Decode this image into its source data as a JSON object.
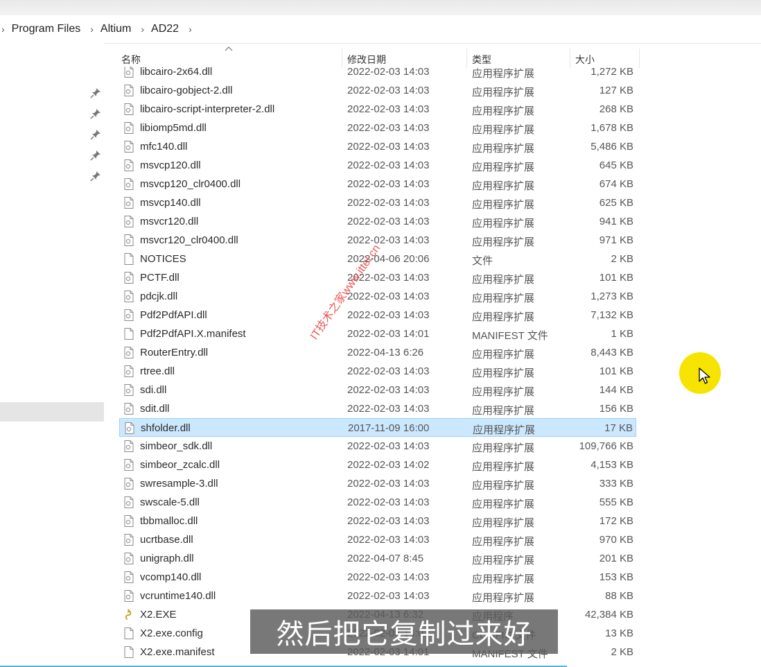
{
  "breadcrumb": [
    "Program Files",
    "Altium",
    "AD22"
  ],
  "columns": {
    "name": "名称",
    "date": "修改日期",
    "type": "类型",
    "size": "大小"
  },
  "files": [
    {
      "name": "libcairo-2x64.dll",
      "date": "2022-02-03 14:03",
      "type": "应用程序扩展",
      "size": "1,272 KB",
      "icon": "dll-file-icon"
    },
    {
      "name": "libcairo-gobject-2.dll",
      "date": "2022-02-03 14:03",
      "type": "应用程序扩展",
      "size": "127 KB",
      "icon": "dll-file-icon"
    },
    {
      "name": "libcairo-script-interpreter-2.dll",
      "date": "2022-02-03 14:03",
      "type": "应用程序扩展",
      "size": "268 KB",
      "icon": "dll-file-icon"
    },
    {
      "name": "libiomp5md.dll",
      "date": "2022-02-03 14:03",
      "type": "应用程序扩展",
      "size": "1,678 KB",
      "icon": "dll-file-icon"
    },
    {
      "name": "mfc140.dll",
      "date": "2022-02-03 14:03",
      "type": "应用程序扩展",
      "size": "5,486 KB",
      "icon": "dll-file-icon"
    },
    {
      "name": "msvcp120.dll",
      "date": "2022-02-03 14:03",
      "type": "应用程序扩展",
      "size": "645 KB",
      "icon": "dll-file-icon"
    },
    {
      "name": "msvcp120_clr0400.dll",
      "date": "2022-02-03 14:03",
      "type": "应用程序扩展",
      "size": "674 KB",
      "icon": "dll-file-icon"
    },
    {
      "name": "msvcp140.dll",
      "date": "2022-02-03 14:03",
      "type": "应用程序扩展",
      "size": "625 KB",
      "icon": "dll-file-icon"
    },
    {
      "name": "msvcr120.dll",
      "date": "2022-02-03 14:03",
      "type": "应用程序扩展",
      "size": "941 KB",
      "icon": "dll-file-icon"
    },
    {
      "name": "msvcr120_clr0400.dll",
      "date": "2022-02-03 14:03",
      "type": "应用程序扩展",
      "size": "971 KB",
      "icon": "dll-file-icon"
    },
    {
      "name": "NOTICES",
      "date": "2022-04-06 20:06",
      "type": "文件",
      "size": "2 KB",
      "icon": "blank-file-icon"
    },
    {
      "name": "PCTF.dll",
      "date": "2022-02-03 14:03",
      "type": "应用程序扩展",
      "size": "101 KB",
      "icon": "dll-file-icon"
    },
    {
      "name": "pdcjk.dll",
      "date": "2022-02-03 14:03",
      "type": "应用程序扩展",
      "size": "1,273 KB",
      "icon": "dll-file-icon"
    },
    {
      "name": "Pdf2PdfAPI.dll",
      "date": "2022-02-03 14:03",
      "type": "应用程序扩展",
      "size": "7,132 KB",
      "icon": "dll-file-icon"
    },
    {
      "name": "Pdf2PdfAPI.X.manifest",
      "date": "2022-02-03 14:01",
      "type": "MANIFEST 文件",
      "size": "1 KB",
      "icon": "blank-file-icon"
    },
    {
      "name": "RouterEntry.dll",
      "date": "2022-04-13 6:26",
      "type": "应用程序扩展",
      "size": "8,443 KB",
      "icon": "dll-file-icon"
    },
    {
      "name": "rtree.dll",
      "date": "2022-02-03 14:03",
      "type": "应用程序扩展",
      "size": "101 KB",
      "icon": "dll-file-icon"
    },
    {
      "name": "sdi.dll",
      "date": "2022-02-03 14:03",
      "type": "应用程序扩展",
      "size": "144 KB",
      "icon": "dll-file-icon"
    },
    {
      "name": "sdit.dll",
      "date": "2022-02-03 14:03",
      "type": "应用程序扩展",
      "size": "156 KB",
      "icon": "dll-file-icon"
    },
    {
      "name": "shfolder.dll",
      "date": "2017-11-09 16:00",
      "type": "应用程序扩展",
      "size": "17 KB",
      "icon": "dll-file-icon",
      "selected": true
    },
    {
      "name": "simbeor_sdk.dll",
      "date": "2022-02-03 14:03",
      "type": "应用程序扩展",
      "size": "109,766 KB",
      "icon": "dll-file-icon"
    },
    {
      "name": "simbeor_zcalc.dll",
      "date": "2022-02-03 14:02",
      "type": "应用程序扩展",
      "size": "4,153 KB",
      "icon": "dll-file-icon"
    },
    {
      "name": "swresample-3.dll",
      "date": "2022-02-03 14:03",
      "type": "应用程序扩展",
      "size": "333 KB",
      "icon": "dll-file-icon"
    },
    {
      "name": "swscale-5.dll",
      "date": "2022-02-03 14:03",
      "type": "应用程序扩展",
      "size": "555 KB",
      "icon": "dll-file-icon"
    },
    {
      "name": "tbbmalloc.dll",
      "date": "2022-02-03 14:03",
      "type": "应用程序扩展",
      "size": "172 KB",
      "icon": "dll-file-icon"
    },
    {
      "name": "ucrtbase.dll",
      "date": "2022-02-03 14:03",
      "type": "应用程序扩展",
      "size": "970 KB",
      "icon": "dll-file-icon"
    },
    {
      "name": "unigraph.dll",
      "date": "2022-04-07 8:45",
      "type": "应用程序扩展",
      "size": "201 KB",
      "icon": "dll-file-icon"
    },
    {
      "name": "vcomp140.dll",
      "date": "2022-02-03 14:03",
      "type": "应用程序扩展",
      "size": "153 KB",
      "icon": "dll-file-icon"
    },
    {
      "name": "vcruntime140.dll",
      "date": "2022-02-03 14:03",
      "type": "应用程序扩展",
      "size": "88 KB",
      "icon": "dll-file-icon"
    },
    {
      "name": "X2.EXE",
      "date": "2022-04-13 6:32",
      "type": "应用程序",
      "size": "42,384 KB",
      "icon": "exe-app-icon"
    },
    {
      "name": "X2.exe.config",
      "date": "2022-02-03 14:01",
      "type": "CONFIG 文件",
      "size": "13 KB",
      "icon": "blank-file-icon"
    },
    {
      "name": "X2.exe.manifest",
      "date": "2022-02-03 14:01",
      "type": "MANIFEST 文件",
      "size": "2 KB",
      "icon": "blank-file-icon"
    }
  ],
  "subtitle": "然后把它复制过来好",
  "watermark": "IT技术之家www.ittel.cn",
  "colors": {
    "selection_bg": "#cce8ff",
    "selection_border": "#99d1ff",
    "cursor_halo": "#f6e400",
    "watermark": "#e63a3a"
  }
}
